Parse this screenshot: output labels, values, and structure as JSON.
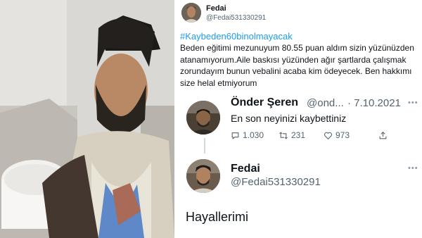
{
  "original": {
    "display_name": "Fedai",
    "username": "@Fedai531330291",
    "hashtag": "#Kaybeden60binolmayacak",
    "text": "Beden eğitimi mezunuyum 80.55 puan aldım sizin yüzünüzden atanamıyorum.Aile baskısı yüzünden  ağır şartlarda çalışmak zorundayım   bunun vebalini acaba kim ödeyecek. Ben hakkımı size helal etmiyorum"
  },
  "reply": {
    "display_name": "Önder Şeren",
    "username_truncated": "@ond...",
    "date": "· 7.10.2021",
    "text": "En son neyinizi kaybettiniz",
    "replies": "1.030",
    "retweets": "231",
    "likes": "973"
  },
  "response": {
    "display_name": "Fedai",
    "username": "@Fedai531330291",
    "text": "Hayallerimi"
  },
  "icons": {
    "reply": "reply-icon",
    "retweet": "retweet-icon",
    "like": "heart-icon",
    "share": "share-icon",
    "more": "more-icon"
  },
  "colors": {
    "text": "#0f1419",
    "secondary": "#536471",
    "link": "#1d9bf0"
  }
}
